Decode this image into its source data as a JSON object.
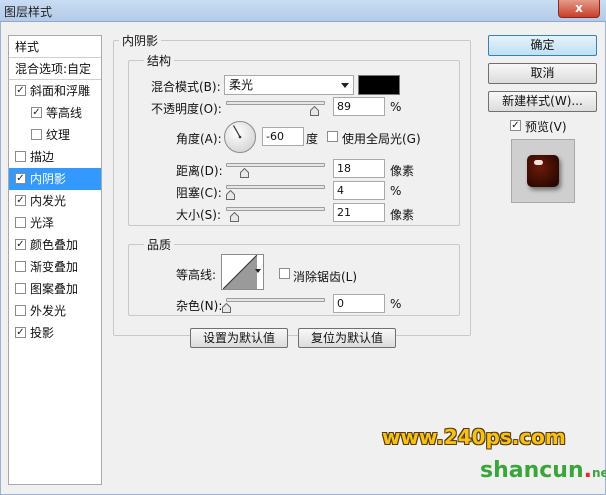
{
  "window": {
    "title": "图层样式",
    "close": "x"
  },
  "style_list": {
    "header": "样式",
    "blend_options": "混合选项:自定",
    "items": [
      {
        "label": "斜面和浮雕",
        "checked": true,
        "indent": false,
        "selected": false
      },
      {
        "label": "等高线",
        "checked": true,
        "indent": true,
        "selected": false
      },
      {
        "label": "纹理",
        "checked": false,
        "indent": true,
        "selected": false
      },
      {
        "label": "描边",
        "checked": false,
        "indent": false,
        "selected": false
      },
      {
        "label": "内阴影",
        "checked": true,
        "indent": false,
        "selected": true
      },
      {
        "label": "内发光",
        "checked": true,
        "indent": false,
        "selected": false
      },
      {
        "label": "光泽",
        "checked": false,
        "indent": false,
        "selected": false
      },
      {
        "label": "颜色叠加",
        "checked": true,
        "indent": false,
        "selected": false
      },
      {
        "label": "渐变叠加",
        "checked": false,
        "indent": false,
        "selected": false
      },
      {
        "label": "图案叠加",
        "checked": false,
        "indent": false,
        "selected": false
      },
      {
        "label": "外发光",
        "checked": false,
        "indent": false,
        "selected": false
      },
      {
        "label": "投影",
        "checked": true,
        "indent": false,
        "selected": false
      }
    ]
  },
  "panel": {
    "title": "内阴影",
    "structure": {
      "title": "结构",
      "blend_mode_label": "混合模式(B):",
      "blend_mode_value": "柔光",
      "shadow_color": "#000000",
      "opacity_label": "不透明度(O):",
      "opacity_value": "89",
      "opacity_unit": "%",
      "opacity_level": 0.89,
      "angle_label": "角度(A):",
      "angle_value": "-60",
      "angle_unit": "度",
      "global_light_label": "使用全局光(G)",
      "global_light_checked": false,
      "distance_label": "距离(D):",
      "distance_value": "18",
      "distance_unit": "像素",
      "distance_level": 0.18,
      "choke_label": "阻塞(C):",
      "choke_value": "4",
      "choke_unit": "%",
      "choke_level": 0.04,
      "size_label": "大小(S):",
      "size_value": "21",
      "size_unit": "像素",
      "size_level": 0.085
    },
    "quality": {
      "title": "品质",
      "contour_label": "等高线:",
      "antialias_label": "消除锯齿(L)",
      "antialias_checked": false,
      "noise_label": "杂色(N):",
      "noise_value": "0",
      "noise_unit": "%",
      "noise_level": 0
    },
    "make_default": "设置为默认值",
    "reset_default": "复位为默认值"
  },
  "buttons": {
    "ok": "确定",
    "cancel": "取消",
    "new_style": "新建样式(W)...",
    "preview_label": "预览(V)",
    "preview_checked": true
  },
  "watermark": {
    "site": "www.240ps.com",
    "brand_a": "shancun",
    "brand_dot": ".",
    "brand_b": "net"
  }
}
